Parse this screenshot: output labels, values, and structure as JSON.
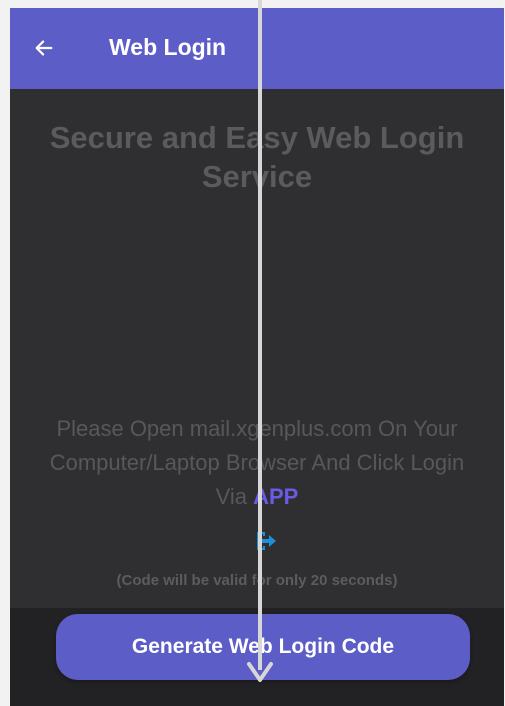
{
  "appbar": {
    "title": "Web Login",
    "back_icon": "arrow-left-icon"
  },
  "main": {
    "headline": "Secure and Easy Web Login Service",
    "instructions": "Please Open mail.xgenplus.com On Your Computer/Laptop Browser And Click Login Via ",
    "app_link": "APP",
    "login_icon": "login-enter-icon",
    "validity_note": "(Code will be valid for only 20 seconds)"
  },
  "footer": {
    "generate_button": "Generate Web Login Code"
  },
  "colors": {
    "accent": "#5d5dc8",
    "background": "#2f2f31",
    "link": "#6a5ae6",
    "icon": "#1e8fd8"
  }
}
